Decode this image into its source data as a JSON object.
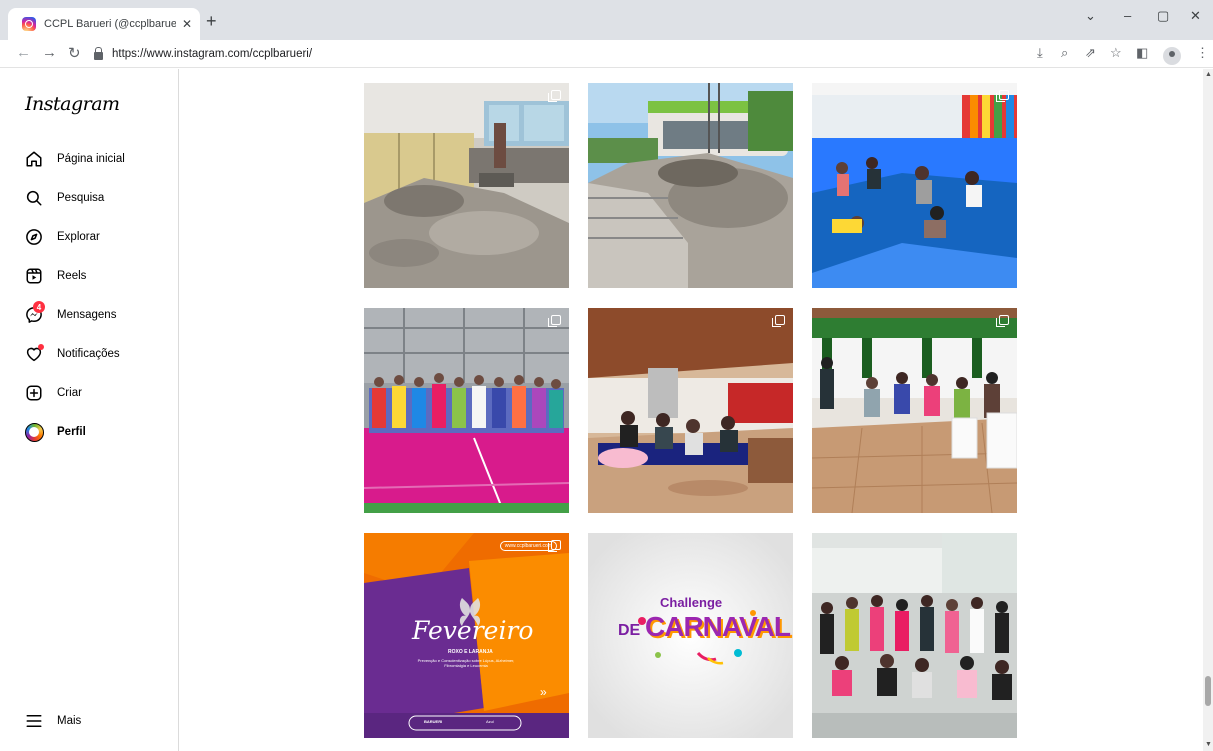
{
  "browser": {
    "tab_title": "CCPL Barueri (@ccplbarueri) • Fo",
    "tab_close": "✕",
    "new_tab": "+",
    "url": "https://www.instagram.com/ccplbarueri/",
    "controls": {
      "minimize": "‒",
      "restore": "▢",
      "close": "✕",
      "dropdown": "⌄"
    },
    "toolbar_icons": [
      "install-icon",
      "zoom-icon",
      "share-icon",
      "bookmark-star-icon",
      "side-panel-icon",
      "profile-icon",
      "menu-icon"
    ]
  },
  "instagram": {
    "logo": "Instagram",
    "nav": [
      {
        "label": "Página inicial",
        "icon": "home-icon"
      },
      {
        "label": "Pesquisa",
        "icon": "search-icon"
      },
      {
        "label": "Explorar",
        "icon": "compass-icon"
      },
      {
        "label": "Reels",
        "icon": "reels-icon"
      },
      {
        "label": "Mensagens",
        "icon": "messenger-icon",
        "badge": "4"
      },
      {
        "label": "Notificações",
        "icon": "heart-icon"
      },
      {
        "label": "Criar",
        "icon": "plus-square-icon"
      },
      {
        "label": "Perfil",
        "icon": "avatar"
      }
    ],
    "more": {
      "label": "Mais",
      "icon": "hamburger-icon"
    },
    "posts": [
      {
        "kind": "photo",
        "description": "construction-interior",
        "multiple": true
      },
      {
        "kind": "photo",
        "description": "construction-exterior",
        "multiple": false
      },
      {
        "kind": "photo",
        "description": "stretching-class",
        "multiple": true
      },
      {
        "kind": "photo",
        "description": "group-gym",
        "multiple": true
      },
      {
        "kind": "photo",
        "description": "group-indoor-mats",
        "multiple": true
      },
      {
        "kind": "photo",
        "description": "group-chairs",
        "multiple": true
      },
      {
        "kind": "graphic",
        "multiple": true,
        "url_tag": "www.ccplbarueri.com",
        "title": "Fevereiro",
        "subtitle": "ROXO E LARANJA",
        "body": "Prevenção e Conscientização sobre Lúpus, Alzheimer, Fibromialgia e Leucemia",
        "footer_left": "BARUERI",
        "footer_right": "Azul"
      },
      {
        "kind": "graphic",
        "multiple": false,
        "title_small": "Challenge",
        "title_de": "DE",
        "title_big": "CARNAVAL"
      },
      {
        "kind": "photo",
        "description": "zumba-group",
        "multiple": false
      }
    ]
  },
  "colors": {
    "accent_badge": "#ff3040",
    "fevereiro_purple": "#6a2c91",
    "fevereiro_orange": "#f57c00",
    "carnaval_purple": "#7b1fa2"
  }
}
